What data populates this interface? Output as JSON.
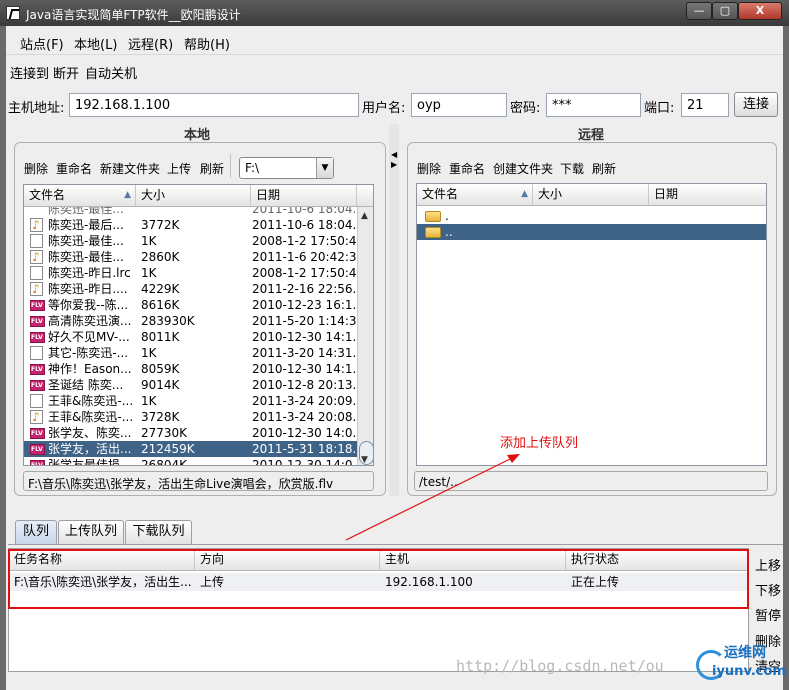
{
  "window": {
    "title": "Java语言实现简单FTP软件__欧阳鹏设计",
    "min": "—",
    "max": "▢",
    "close": "X"
  },
  "menu": [
    "站点(F)",
    "本地(L)",
    "远程(R)",
    "帮助(H)"
  ],
  "toolbar": [
    "连接到",
    "断开",
    "自动关机"
  ],
  "connection": {
    "host_label": "主机地址:",
    "host": "192.168.1.100",
    "user_label": "用户名:",
    "user": "oyp",
    "pass_label": "密码:",
    "pass": "***",
    "port_label": "端口:",
    "port": "21",
    "connect_label": "连接"
  },
  "local": {
    "title": "本地",
    "tools": [
      "删除",
      "重命名",
      "新建文件夹",
      "上传",
      "刷新"
    ],
    "drive": "F:\\",
    "columns": [
      "文件名",
      "大小",
      "日期"
    ],
    "rows": [
      {
        "name": "陈奕迅-最后...",
        "size": "3772K",
        "date": "2011-10-6 18:04...",
        "icon": "music"
      },
      {
        "name": "陈奕迅-最佳...",
        "size": "1K",
        "date": "2008-1-2 17:50:48",
        "icon": "doc"
      },
      {
        "name": "陈奕迅-最佳...",
        "size": "2860K",
        "date": "2011-1-6 20:42:31",
        "icon": "music"
      },
      {
        "name": "陈奕迅-昨日.lrc",
        "size": "1K",
        "date": "2008-1-2 17:50:48",
        "icon": "doc"
      },
      {
        "name": "陈奕迅-昨日....",
        "size": "4229K",
        "date": "2011-2-16 22:56...",
        "icon": "music"
      },
      {
        "name": "等你爱我--陈...",
        "size": "8616K",
        "date": "2010-12-23 16:1...",
        "icon": "flv"
      },
      {
        "name": "高清陈奕迅演...",
        "size": "283930K",
        "date": "2011-5-20 1:14:33",
        "icon": "flv"
      },
      {
        "name": "好久不见MV-...",
        "size": "8011K",
        "date": "2010-12-30 14:1...",
        "icon": "flv"
      },
      {
        "name": "其它-陈奕迅-...",
        "size": "1K",
        "date": "2011-3-20 14:31...",
        "icon": "doc"
      },
      {
        "name": "神作！Eason...",
        "size": "8059K",
        "date": "2010-12-30 14:1...",
        "icon": "flv"
      },
      {
        "name": "圣诞结 陈奕...",
        "size": "9014K",
        "date": "2010-12-8 20:13...",
        "icon": "flv"
      },
      {
        "name": "王菲&陈奕迅-...",
        "size": "1K",
        "date": "2011-3-24 20:09...",
        "icon": "doc"
      },
      {
        "name": "王菲&陈奕迅-...",
        "size": "3728K",
        "date": "2011-3-24 20:08...",
        "icon": "music"
      },
      {
        "name": "张学友、陈奕...",
        "size": "27730K",
        "date": "2010-12-30 14:0...",
        "icon": "flv"
      },
      {
        "name": "张学友，活出...",
        "size": "212459K",
        "date": "2011-5-31 18:18...",
        "icon": "flv",
        "selected": true
      },
      {
        "name": "张学友最佳损...",
        "size": "26804K",
        "date": "2010-12-30 14:0...",
        "icon": "flv"
      }
    ],
    "status_path": "F:\\音乐\\陈奕迅\\张学友，活出生命Live演唱会，欣赏版.flv"
  },
  "remote": {
    "title": "远程",
    "tools": [
      "删除",
      "重命名",
      "创建文件夹",
      "下载",
      "刷新"
    ],
    "columns": [
      "文件名",
      "大小",
      "日期"
    ],
    "rows": [
      {
        "name": ".",
        "icon": "folder"
      },
      {
        "name": "..",
        "icon": "folder",
        "selected": true
      }
    ],
    "status_path": "/test/.."
  },
  "annotation": "添加上传队列",
  "tabs": [
    "队列",
    "上传队列",
    "下载队列"
  ],
  "queue": {
    "columns": [
      "任务名称",
      "方向",
      "主机",
      "执行状态"
    ],
    "rows": [
      {
        "task": "F:\\音乐\\陈奕迅\\张学友，活出生...",
        "direction": "上传",
        "host": "192.168.1.100",
        "status": "正在上传"
      }
    ]
  },
  "side_buttons": [
    "上移",
    "下移",
    "暂停",
    "删除",
    "清空"
  ],
  "watermark": "http://blog.csdn.net/ou",
  "logo": {
    "line1": "运维网",
    "line2": "iyunv.com"
  }
}
